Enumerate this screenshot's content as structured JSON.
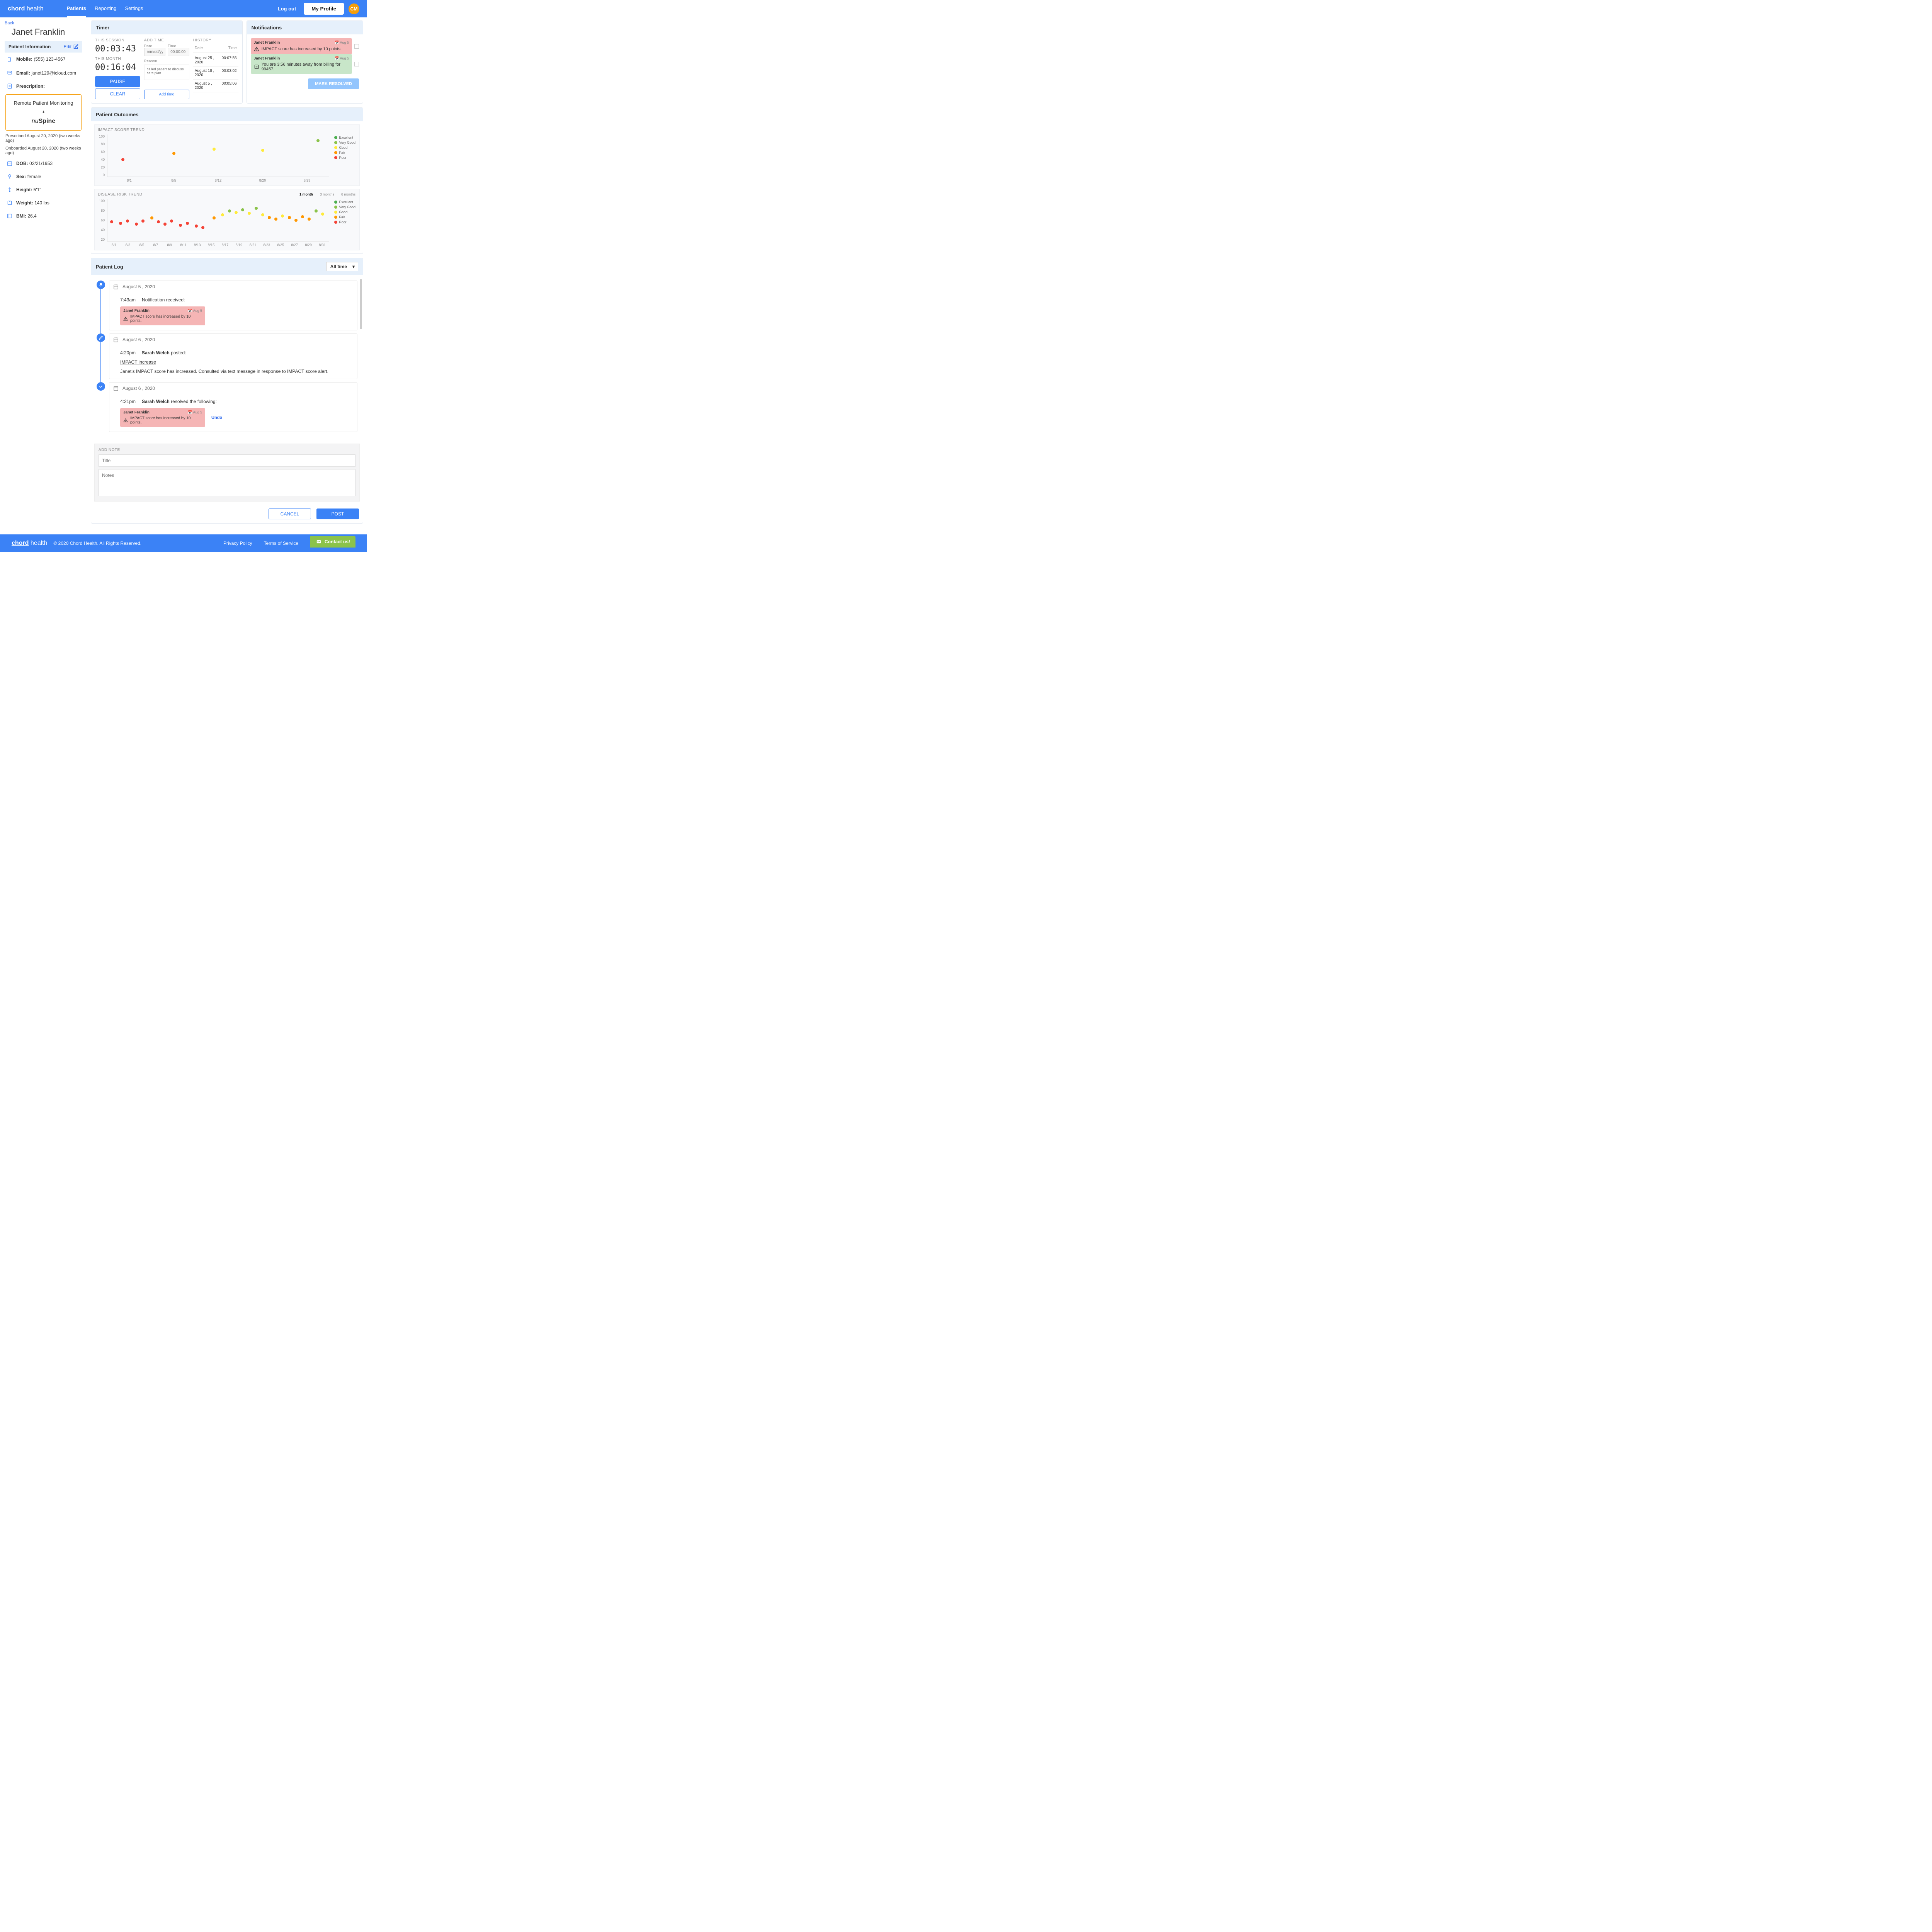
{
  "brand": {
    "part1": "chord",
    "part2": " health"
  },
  "nav": {
    "patients": "Patients",
    "reporting": "Reporting",
    "settings": "Settings"
  },
  "header": {
    "logout": "Log out",
    "profile": "My Profile",
    "initials": "CM"
  },
  "patient": {
    "back": "Back",
    "name": "Janet Franklin",
    "info_header": "Patient Information",
    "edit": "Edit",
    "mobile_label": "Mobile:",
    "mobile": "(555) 123-4567",
    "email_label": "Email:",
    "email": "janet129@icloud.com",
    "rx_label": "Prescription:",
    "rx_title": "Remote Patient Monitoring",
    "rx_plus": "+",
    "rx_brand_i": "nu",
    "rx_brand_b": "Spine",
    "prescribed": "Prescribed August 20, 2020 (two weeks ago)",
    "onboarded": "Onboarded August 20, 2020 (two weeks ago)",
    "dob_label": "DOB:",
    "dob": "02/21/1953",
    "sex_label": "Sex:",
    "sex": "female",
    "height_label": "Height:",
    "height": "5'1\"",
    "weight_label": "Weight:",
    "weight": "140 lbs",
    "bmi_label": "BMI:",
    "bmi": "26.4"
  },
  "timer": {
    "title": "Timer",
    "session_label": "THIS SESSION",
    "session": "00:03:43",
    "month_label": "THIS MONTH",
    "month": "00:16:04",
    "pause": "PAUSE",
    "clear": "CLEAR",
    "add_time_label": "ADD TIME",
    "date_label": "Date",
    "date_ph": "mm/dd/yyyy",
    "time_label": "Time",
    "time_ph": "00:00:00",
    "reason_label": "Reason",
    "reason_text": "called patient to discuss care plan.",
    "add_time_btn": "Add time",
    "history_label": "HISTORY",
    "hist_date": "Date",
    "hist_time": "Time",
    "history": [
      {
        "date": "August 25 , 2020",
        "time": "00:07:56"
      },
      {
        "date": "August 18 , 2020",
        "time": "00:03:02"
      },
      {
        "date": "August 5 , 2020",
        "time": "00:05:06"
      }
    ]
  },
  "notifications": {
    "title": "Notifications",
    "resolved": "MARK RESOLVED",
    "items": [
      {
        "name": "Janet Franklin",
        "date": "Aug 5",
        "msg": "IMPACT score has increased by 10 points.",
        "type": "red"
      },
      {
        "name": "Janet Franklin",
        "date": "Aug 5",
        "msg": "You are 3:56 minutes away from billing for 99457.",
        "type": "green"
      }
    ]
  },
  "outcomes": {
    "title": "Patient Outcomes",
    "legend": {
      "excellent": "Excellent",
      "verygood": "Very Good",
      "good": "Good",
      "fair": "Fair",
      "poor": "Poor"
    },
    "colors": {
      "excellent": "#4caf50",
      "verygood": "#8bc34a",
      "good": "#ffeb3b",
      "fair": "#ff9800",
      "poor": "#f44336"
    }
  },
  "chart_data": [
    {
      "type": "scatter",
      "title": "IMPACT SCORE TREND",
      "ylabel": "",
      "xlabel": "",
      "ylim": [
        0,
        100
      ],
      "y_ticks": [
        100,
        80,
        60,
        40,
        20,
        0
      ],
      "x_ticks": [
        "8/1",
        "8/5",
        "8/12",
        "8/20",
        "8/29"
      ],
      "points": [
        {
          "x": 7,
          "y": 40,
          "color": "#f44336"
        },
        {
          "x": 30,
          "y": 55,
          "color": "#ff9800"
        },
        {
          "x": 48,
          "y": 65,
          "color": "#ffeb3b"
        },
        {
          "x": 70,
          "y": 62,
          "color": "#ffeb3b"
        },
        {
          "x": 95,
          "y": 85,
          "color": "#8bc34a"
        }
      ]
    },
    {
      "type": "scatter",
      "title": "DISEASE RISK TREND",
      "ylabel": "",
      "xlabel": "",
      "ylim": [
        0,
        100
      ],
      "y_ticks": [
        100,
        80,
        60,
        40,
        20
      ],
      "x_ticks": [
        "8/1",
        "8/3",
        "8/5",
        "8/7",
        "8/9",
        "8/11",
        "8/13",
        "8/15",
        "8/17",
        "8/19",
        "8/21",
        "8/23",
        "8/25",
        "8/27",
        "8/29",
        "8/31"
      ],
      "time_ranges": [
        "1 month",
        "3 months",
        "6 months"
      ],
      "active_range": "1 month",
      "points": [
        {
          "x": 2,
          "y": 46,
          "color": "#f44336"
        },
        {
          "x": 6,
          "y": 42,
          "color": "#f44336"
        },
        {
          "x": 9,
          "y": 48,
          "color": "#f44336"
        },
        {
          "x": 13,
          "y": 40,
          "color": "#f44336"
        },
        {
          "x": 16,
          "y": 48,
          "color": "#f44336"
        },
        {
          "x": 20,
          "y": 55,
          "color": "#ff9800"
        },
        {
          "x": 23,
          "y": 46,
          "color": "#f44336"
        },
        {
          "x": 26,
          "y": 40,
          "color": "#f44336"
        },
        {
          "x": 29,
          "y": 48,
          "color": "#f44336"
        },
        {
          "x": 33,
          "y": 38,
          "color": "#f44336"
        },
        {
          "x": 36,
          "y": 42,
          "color": "#f44336"
        },
        {
          "x": 40,
          "y": 36,
          "color": "#f44336"
        },
        {
          "x": 43,
          "y": 32,
          "color": "#f44336"
        },
        {
          "x": 48,
          "y": 55,
          "color": "#ff9800"
        },
        {
          "x": 52,
          "y": 62,
          "color": "#ffeb3b"
        },
        {
          "x": 55,
          "y": 72,
          "color": "#8bc34a"
        },
        {
          "x": 58,
          "y": 68,
          "color": "#ffeb3b"
        },
        {
          "x": 61,
          "y": 74,
          "color": "#8bc34a"
        },
        {
          "x": 64,
          "y": 66,
          "color": "#ffeb3b"
        },
        {
          "x": 67,
          "y": 78,
          "color": "#8bc34a"
        },
        {
          "x": 70,
          "y": 62,
          "color": "#ffeb3b"
        },
        {
          "x": 73,
          "y": 56,
          "color": "#ff9800"
        },
        {
          "x": 76,
          "y": 52,
          "color": "#ff9800"
        },
        {
          "x": 79,
          "y": 60,
          "color": "#ffeb3b"
        },
        {
          "x": 82,
          "y": 56,
          "color": "#ff9800"
        },
        {
          "x": 85,
          "y": 50,
          "color": "#ff9800"
        },
        {
          "x": 88,
          "y": 58,
          "color": "#ff9800"
        },
        {
          "x": 91,
          "y": 52,
          "color": "#ff9800"
        },
        {
          "x": 94,
          "y": 72,
          "color": "#8bc34a"
        },
        {
          "x": 97,
          "y": 64,
          "color": "#ffeb3b"
        }
      ]
    }
  ],
  "log": {
    "title": "Patient Log",
    "filter": "All time",
    "undo": "Undo",
    "entries": [
      {
        "icon": "bell",
        "color": "#3b82f6",
        "date": "August 5 , 2020",
        "time": "7:43am",
        "text": "Notification received:",
        "notif": {
          "name": "Janet Franklin",
          "date": "Aug 5",
          "msg": "IMPACT score has increased by 10 points."
        }
      },
      {
        "icon": "edit",
        "color": "#3b82f6",
        "date": "August 6 , 2020",
        "time": "4:20pm",
        "author": "Sarah Welch",
        "action": " posted:",
        "subject": "IMPACT increase",
        "body": "Janet's IMPACT score has increased.  Consulted via text message in response to IMPACT score alert."
      },
      {
        "icon": "check",
        "color": "#3b82f6",
        "date": "August 6 , 2020",
        "time": "4:21pm",
        "author": "Sarah Welch",
        "action": " resolved the following:",
        "notif": {
          "name": "Janet Franklin",
          "date": "Aug 5",
          "msg": "IMPACT score has increased by 10 points."
        },
        "undo": true
      }
    ],
    "add_note": {
      "label": "ADD NOTE",
      "title_ph": "Title",
      "notes_ph": "Notes",
      "cancel": "CANCEL",
      "post": "POST"
    }
  },
  "footer": {
    "copy": "© 2020 Chord Health. All Rights Reserved.",
    "privacy": "Privacy Policy",
    "terms": "Terms of Service",
    "contact": "Contact us!"
  }
}
